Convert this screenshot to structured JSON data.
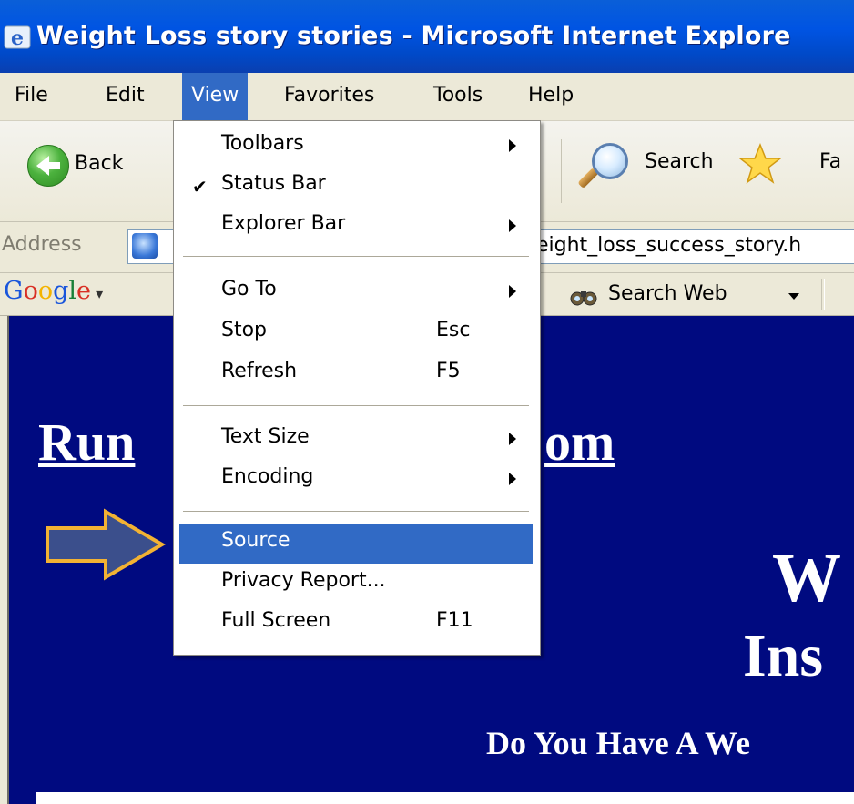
{
  "window": {
    "title": "Weight Loss story stories - Microsoft Internet Explore"
  },
  "menubar": {
    "items": [
      "File",
      "Edit",
      "View",
      "Favorites",
      "Tools",
      "Help"
    ],
    "active": "View"
  },
  "toolbar": {
    "back_label": "Back",
    "search_label": "Search",
    "favorites_label": "Fa"
  },
  "addressbar": {
    "label": "Address",
    "value": "eight_loss_success_story.h"
  },
  "google_toolbar": {
    "logo": "Google",
    "search_web_label": "Search Web"
  },
  "view_menu": {
    "items": [
      {
        "label": "Toolbars",
        "submenu": true
      },
      {
        "label": "Status Bar",
        "checked": true
      },
      {
        "label": "Explorer Bar",
        "submenu": true
      },
      {
        "label": "Go To",
        "submenu": true
      },
      {
        "label": "Stop",
        "shortcut": "Esc"
      },
      {
        "label": "Refresh",
        "shortcut": "F5"
      },
      {
        "label": "Text Size",
        "submenu": true
      },
      {
        "label": "Encoding",
        "submenu": true
      },
      {
        "label": "Source",
        "selected": true
      },
      {
        "label": "Privacy Report..."
      },
      {
        "label": "Full Screen",
        "shortcut": "F11"
      }
    ]
  },
  "page": {
    "site_link_left": "Run",
    "site_link_right": "om",
    "headline_1": "W",
    "headline_2": "Ins",
    "headline_3": "Do You Have A We"
  },
  "colors": {
    "title_bar": "#0054e3",
    "menu_highlight": "#316ac5",
    "page_background": "#000a80",
    "callout_fill": "#3b4f8c",
    "callout_stroke": "#f2b233"
  }
}
